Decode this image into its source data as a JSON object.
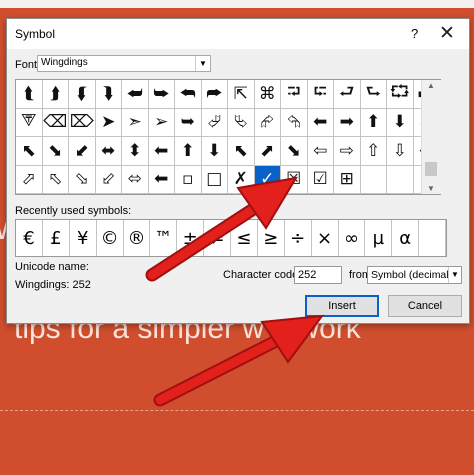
{
  "background": {
    "partial_text_1": "W",
    "partial_text_2": "tips for a simpler w    o work"
  },
  "dialog": {
    "title": "Symbol",
    "help_glyph": "?",
    "close_glyph": "✕",
    "font_label": "Font:",
    "font_value": "Wingdings",
    "symbols": [
      "⮬",
      "⮭",
      "⮮",
      "⮯",
      "⮨",
      "⮩",
      "⮪",
      "⮫",
      "⇱",
      "⌘",
      "⮒",
      "⮓",
      "⮐",
      "⮑",
      "⮔",
      "⮕",
      "⮗",
      "⌫",
      "⌦",
      "➤",
      "➣",
      "➢",
      "➥",
      "⮰",
      "⮱",
      "⮳",
      "⮲",
      "⬅",
      "➡",
      "⬆",
      "⬇",
      "⬈",
      "⬉",
      "⬊",
      "⬋",
      "⬌",
      "⬍",
      "⬅",
      "⬆",
      "⬇",
      "⬉",
      "⬈",
      "⬊",
      "⇦",
      "⇨",
      "⇧",
      "⇩",
      "⬄",
      "⬀",
      "⬁",
      "⬂",
      "⬃",
      "⬄",
      "⬅",
      "▫",
      "□",
      "✗",
      "✓",
      "☒",
      "☑",
      "⊞",
      "",
      "",
      ""
    ],
    "selected_index": 57,
    "recent_label": "Recently used symbols:",
    "recent": [
      "€",
      "£",
      "¥",
      "©",
      "®",
      "™",
      "±",
      "≠",
      "≤",
      "≥",
      "÷",
      "×",
      "∞",
      "µ",
      "α",
      ""
    ],
    "unicode_label": "Unicode name:",
    "unicode_value": "Wingdings: 252",
    "char_code_label": "Character code:",
    "char_code_value": "252",
    "from_label": "from:",
    "from_value": "Symbol (decimal)",
    "insert_label": "Insert",
    "cancel_label": "Cancel"
  },
  "colors": {
    "background": "#d04e2e",
    "selection": "#0a62c9",
    "arrow": "#e3201b"
  }
}
